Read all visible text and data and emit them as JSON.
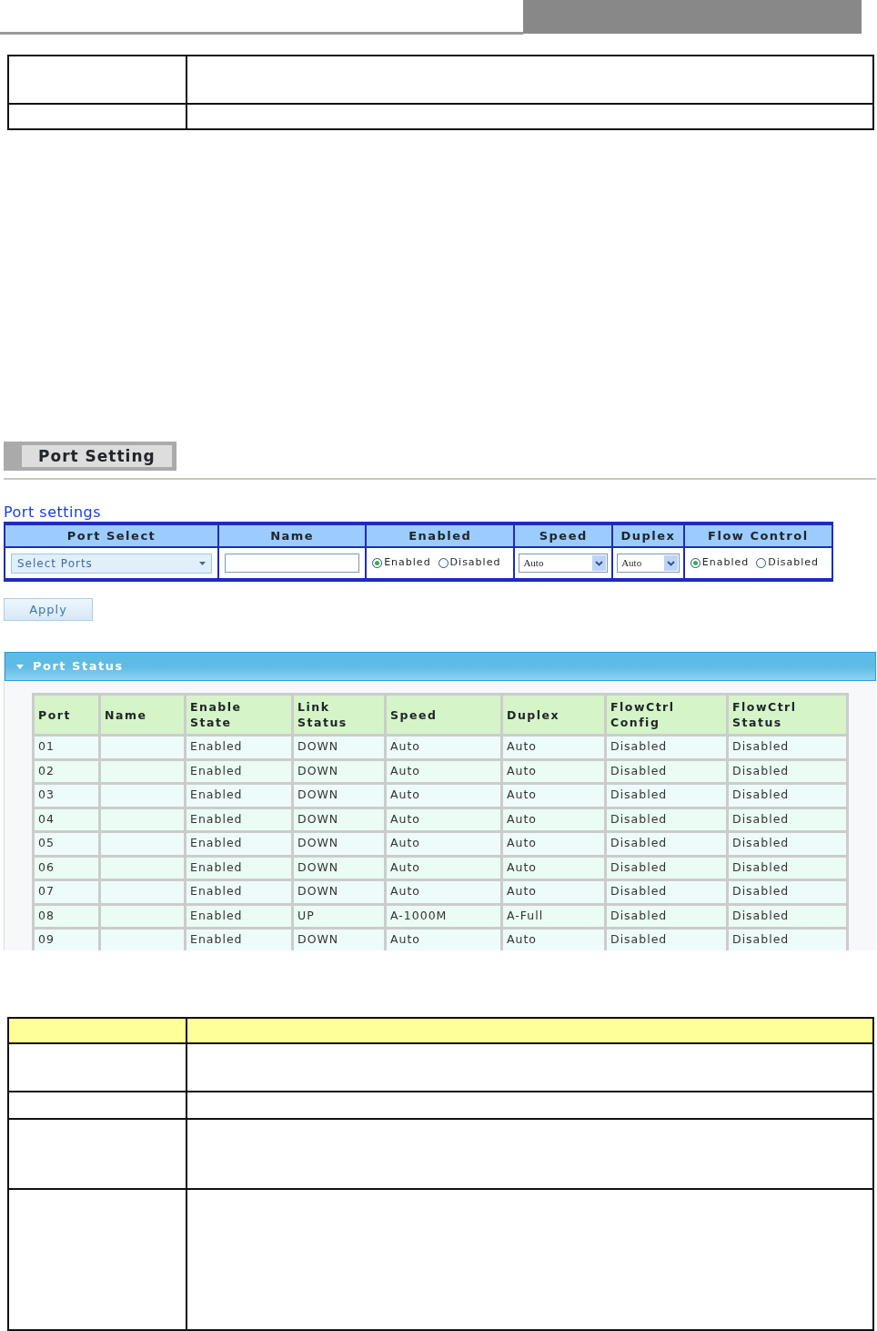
{
  "page_title": "Port Setting",
  "section_title": "Port settings",
  "settings_table": {
    "columns": [
      "Port Select",
      "Name",
      "Enabled",
      "Speed",
      "Duplex",
      "Flow Control"
    ],
    "port_select": {
      "value": "Select Ports"
    },
    "enabled": [
      {
        "label": "Enabled",
        "selected": true
      },
      {
        "label": "Disabled",
        "selected": false
      }
    ],
    "speed": {
      "value": "Auto"
    },
    "duplex": {
      "value": "Auto"
    },
    "flow_control": [
      {
        "label": "Enabled",
        "selected": true
      },
      {
        "label": "Disabled",
        "selected": false
      }
    ]
  },
  "apply_button": "Apply",
  "port_status": {
    "title": "Port Status",
    "expanded": true,
    "columns": [
      "Port",
      "Name",
      "Enable\nState",
      "Link\nStatus",
      "Speed",
      "Duplex",
      "FlowCtrl\nConfig",
      "FlowCtrl\nStatus"
    ],
    "rows": [
      [
        "01",
        "",
        "Enabled",
        "DOWN",
        "Auto",
        "Auto",
        "Disabled",
        "Disabled"
      ],
      [
        "02",
        "",
        "Enabled",
        "DOWN",
        "Auto",
        "Auto",
        "Disabled",
        "Disabled"
      ],
      [
        "03",
        "",
        "Enabled",
        "DOWN",
        "Auto",
        "Auto",
        "Disabled",
        "Disabled"
      ],
      [
        "04",
        "",
        "Enabled",
        "DOWN",
        "Auto",
        "Auto",
        "Disabled",
        "Disabled"
      ],
      [
        "05",
        "",
        "Enabled",
        "DOWN",
        "Auto",
        "Auto",
        "Disabled",
        "Disabled"
      ],
      [
        "06",
        "",
        "Enabled",
        "DOWN",
        "Auto",
        "Auto",
        "Disabled",
        "Disabled"
      ],
      [
        "07",
        "",
        "Enabled",
        "DOWN",
        "Auto",
        "Auto",
        "Disabled",
        "Disabled"
      ],
      [
        "08",
        "",
        "Enabled",
        "UP",
        "A-1000M",
        "A-Full",
        "Disabled",
        "Disabled"
      ],
      [
        "09",
        "",
        "Enabled",
        "DOWN",
        "Auto",
        "Auto",
        "Disabled",
        "Disabled"
      ]
    ]
  }
}
